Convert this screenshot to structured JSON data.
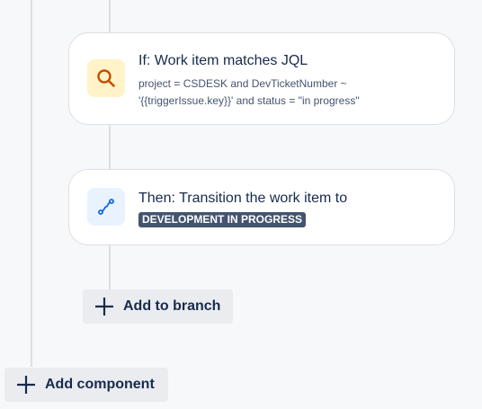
{
  "if_card": {
    "icon": "search-icon",
    "title": "If: Work item matches JQL",
    "jql_line1": "project = CSDESK and DevTicketNumber ~",
    "jql_line2": "'{{triggerIssue.key}}' and status = \"in progress\""
  },
  "then_card": {
    "icon": "transition-icon",
    "title": "Then: Transition the work item to",
    "status_lozenge": "DEVELOPMENT IN PROGRESS"
  },
  "buttons": {
    "add_to_branch": "Add to branch",
    "add_component": "Add component"
  },
  "colors": {
    "background": "#f7f8f9",
    "if_icon_bg": "#fff3c7",
    "if_icon_fg": "#c25100",
    "then_icon_bg": "#e9f2ff",
    "then_icon_fg": "#0c66e4",
    "lozenge_bg": "#44546f"
  }
}
